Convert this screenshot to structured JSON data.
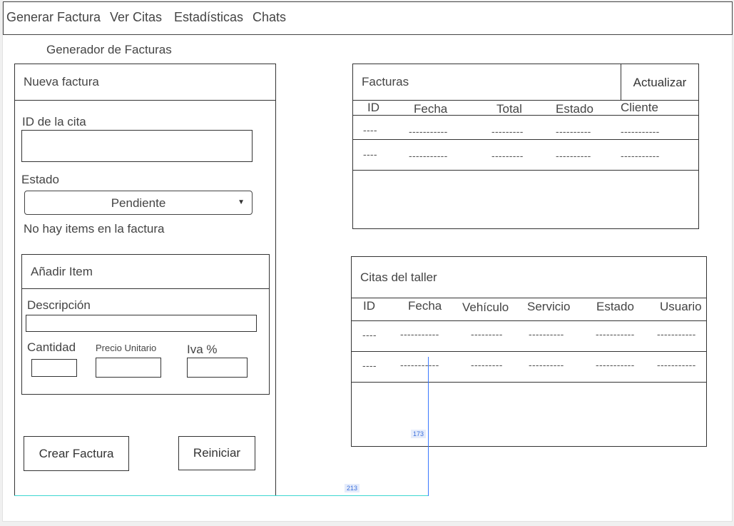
{
  "nav": {
    "items": [
      {
        "label": "Generar Factura"
      },
      {
        "label": "Ver Citas"
      },
      {
        "label": "Estadísticas"
      },
      {
        "label": "Chats"
      }
    ]
  },
  "page_title": "Generador de Facturas",
  "form": {
    "header": "Nueva factura",
    "cita_label": "ID de la cita",
    "cita_value": "",
    "estado_label": "Estado",
    "estado_value": "Pendiente",
    "no_items_text": "No hay items en la factura",
    "add_item": {
      "header": "Añadir Item",
      "descripcion_label": "Descripción",
      "cantidad_label": "Cantidad",
      "precio_label": "Precio Unitario",
      "iva_label": "Iva %"
    },
    "create_label": "Crear Factura",
    "reset_label": "Reiniciar"
  },
  "facturas": {
    "title": "Facturas",
    "refresh_label": "Actualizar",
    "headers": [
      "ID",
      "Fecha",
      "Total",
      "Estado",
      "Cliente"
    ],
    "rows": [
      [
        "----",
        "-----------",
        "---------",
        "----------",
        "-----------"
      ],
      [
        "----",
        "-----------",
        "---------",
        "----------",
        "-----------"
      ]
    ]
  },
  "citas": {
    "title": "Citas del taller",
    "headers": [
      "ID",
      "Fecha",
      "Vehículo",
      "Servicio",
      "Estado",
      "Usuario"
    ],
    "rows": [
      [
        "----",
        "-----------",
        "---------",
        "----------",
        "-----------",
        "-----------"
      ],
      [
        "----",
        "-----------",
        "---------",
        "----------",
        "-----------",
        "-----------"
      ]
    ]
  },
  "measurements": {
    "vertical": "173",
    "horizontal": "213"
  },
  "colors": {
    "border": "#333333",
    "measure_vertical": "#3a78ff",
    "measure_horizontal": "#3dd6d0"
  }
}
